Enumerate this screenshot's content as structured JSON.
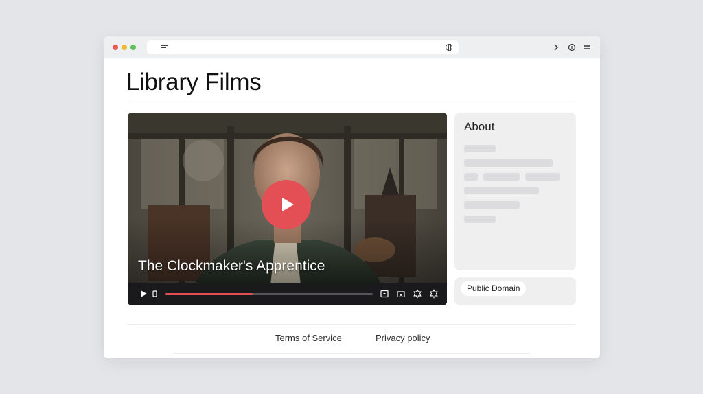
{
  "window": {
    "traffic_lights": {
      "close": "#e8594f",
      "minimize": "#f0b73a",
      "maximize": "#5ec35b"
    }
  },
  "page": {
    "title": "Library Films"
  },
  "video": {
    "title": "The Clockmaker's Apprentice",
    "progress": 0.42,
    "accent_color": "#e34f55"
  },
  "sidebar": {
    "about_title": "About",
    "license_badge": "Public Domain"
  },
  "footer": {
    "links": [
      "Terms of Service",
      "Privacy policy"
    ]
  },
  "icons": {
    "url_menu": "menu-lines-icon",
    "url_globe": "globe-icon",
    "toolbar": [
      "chevron-right-icon",
      "info-icon",
      "hamburger-menu-icon"
    ],
    "player_controls": [
      "play-icon",
      "volume-icon",
      "captions-icon",
      "cast-icon",
      "settings-icon",
      "fullscreen-icon"
    ]
  }
}
